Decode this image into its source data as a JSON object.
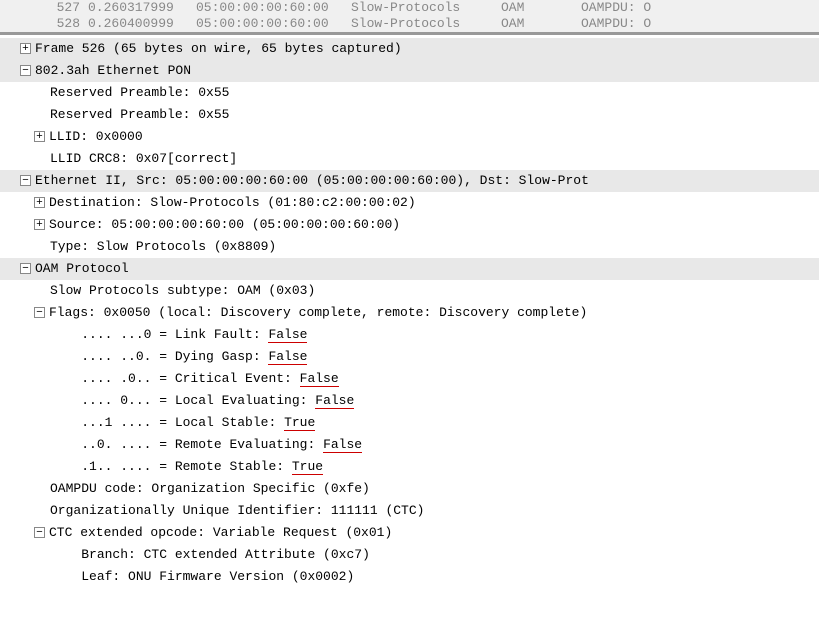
{
  "packet_list": [
    {
      "no": "527",
      "time": "0.260317999",
      "src": "05:00:00:00:60:00",
      "dst": "Slow-Protocols",
      "proto": "OAM",
      "info": "OAMPDU: O"
    },
    {
      "no": "528",
      "time": "0.260400999",
      "src": "05:00:00:00:60:00",
      "dst": "Slow-Protocols",
      "proto": "OAM",
      "info": "OAMPDU: O"
    }
  ],
  "tree": {
    "frame_summary": "Frame 526 (65 bytes on wire, 65 bytes captured)",
    "pon_header": "802.3ah Ethernet PON",
    "pon": {
      "resv1": "Reserved Preamble: 0x55",
      "resv2": "Reserved Preamble: 0x55",
      "llid": "LLID: 0x0000",
      "llid_crc": "LLID CRC8: 0x07[correct]"
    },
    "eth_header": "Ethernet II, Src: 05:00:00:00:60:00 (05:00:00:00:60:00), Dst: Slow-Prot",
    "eth": {
      "dst": "Destination: Slow-Protocols (01:80:c2:00:00:02)",
      "src": "Source: 05:00:00:00:60:00 (05:00:00:00:60:00)",
      "type": "Type: Slow Protocols (0x8809)"
    },
    "oam_header": "OAM Protocol",
    "oam": {
      "subtype": "Slow Protocols subtype: OAM (0x03)",
      "flags_header": "Flags: 0x0050 (local: Discovery complete, remote: Discovery complete)",
      "flags": {
        "link_fault_bits": ".... ...0 = Link Fault: ",
        "link_fault_val": "False",
        "dying_gasp_bits": ".... ..0. = Dying Gasp: ",
        "dying_gasp_val": "False",
        "crit_event_bits": ".... .0.. = Critical Event: ",
        "crit_event_val": "False",
        "local_eval_bits": ".... 0... = Local Evaluating: ",
        "local_eval_val": "False",
        "local_stable_bits": "...1 .... = Local Stable: ",
        "local_stable_val": "True",
        "remote_eval_bits": "..0. .... = Remote Evaluating: ",
        "remote_eval_val": "False",
        "remote_stable_bits": ".1.. .... = Remote Stable: ",
        "remote_stable_val": "True"
      },
      "code": "OAMPDU code: Organization Specific (0xfe)",
      "oui": "Organizationally Unique Identifier: 111111 (CTC)",
      "ctc_header": "CTC extended opcode: Variable Request (0x01)",
      "ctc": {
        "branch": "Branch: CTC extended Attribute (0xc7)",
        "leaf": "Leaf: ONU Firmware Version (0x0002)"
      }
    }
  },
  "chart_data": {
    "type": "table",
    "title": "OAM Flags bitfield (0x0050)",
    "categories": [
      "Link Fault",
      "Dying Gasp",
      "Critical Event",
      "Local Evaluating",
      "Local Stable",
      "Remote Evaluating",
      "Remote Stable"
    ],
    "values": [
      0,
      0,
      0,
      0,
      1,
      0,
      1
    ],
    "labels": [
      "False",
      "False",
      "False",
      "False",
      "True",
      "False",
      "True"
    ]
  }
}
